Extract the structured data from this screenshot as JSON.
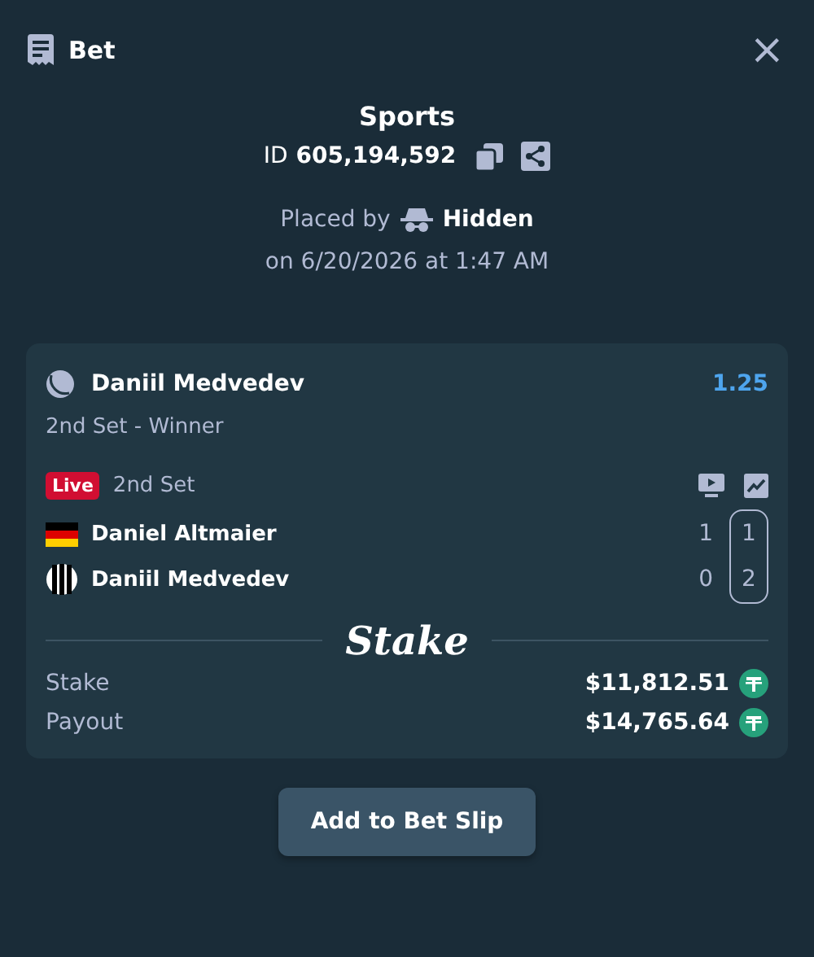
{
  "header": {
    "title": "Bet",
    "close": "×"
  },
  "summary": {
    "title": "Sports",
    "id_label": "ID",
    "id_value": "605,194,592",
    "placed_by_label": "Placed by",
    "placed_by_user": "Hidden",
    "placed_on": "on 6/20/2026 at 1:47 AM"
  },
  "selection": {
    "name": "Daniil Medvedev",
    "odds": "1.25",
    "market": "2nd Set - Winner"
  },
  "event": {
    "live_badge": "Live",
    "status": "2nd Set",
    "players": [
      {
        "name": "Daniel Altmaier",
        "kind": "flag",
        "scores": [
          "1",
          "1"
        ]
      },
      {
        "name": "Daniil Medvedev",
        "kind": "neutral",
        "scores": [
          "0",
          "2"
        ]
      }
    ]
  },
  "brand": "Stake",
  "totals": [
    {
      "label": "Stake",
      "amount": "$11,812.51"
    },
    {
      "label": "Payout",
      "amount": "$14,765.64"
    }
  ],
  "action_button": "Add to Bet Slip"
}
